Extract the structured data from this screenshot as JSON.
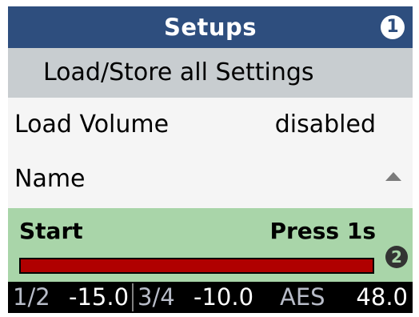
{
  "header": {
    "title": "Setups",
    "badge": "1"
  },
  "subtitle": "Load/Store all Settings",
  "rows": [
    {
      "label": "Load Volume",
      "value": "disabled"
    },
    {
      "label": "Name",
      "indicator": "scroll-up-icon"
    }
  ],
  "action": {
    "label": "Start",
    "hint": "Press 1s",
    "progress": 1.0,
    "badge": "2"
  },
  "status": {
    "channel_a": "1/2",
    "level_a": "-15.0",
    "channel_b": "3/4",
    "level_b": "-10.0",
    "source": "AES",
    "rate": "48.0"
  },
  "colors": {
    "title_bg": "#2e4e7e",
    "subtitle_bg": "#c8cdd0",
    "list_bg": "#f5f5f5",
    "action_bg": "#a9d5a9",
    "progress_fill": "#b00000",
    "status_bg": "#000000"
  }
}
